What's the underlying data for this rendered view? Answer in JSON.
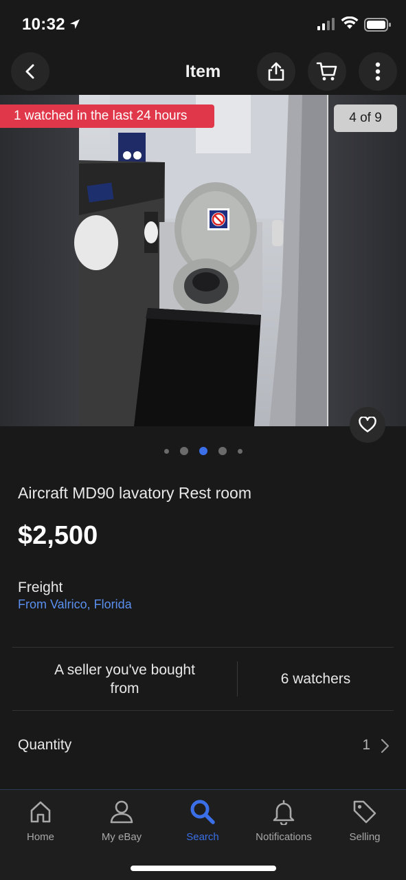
{
  "status_bar": {
    "time": "10:32"
  },
  "header": {
    "title": "Item",
    "icons": [
      "back-icon",
      "share-icon",
      "cart-icon",
      "more-icon"
    ]
  },
  "gallery": {
    "watch_banner": "1 watched in the last 24 hours",
    "counter": "4 of 9",
    "current_index": 3,
    "total_dots": 5
  },
  "item": {
    "title": "Aircraft MD90 lavatory Rest room",
    "price": "$2,500",
    "shipping_label": "Freight",
    "location": "From Valrico, Florida"
  },
  "stats": {
    "seller_note": "A seller you've bought from",
    "watchers": "6 watchers"
  },
  "quantity": {
    "label": "Quantity",
    "value": "1"
  },
  "tabbar": {
    "home": "Home",
    "my_ebay": "My eBay",
    "search": "Search",
    "notifications": "Notifications",
    "selling": "Selling"
  },
  "colors": {
    "accent": "#3a6fe8",
    "banner": "#e0384a",
    "background": "#191919",
    "link": "#5b8ff0"
  }
}
